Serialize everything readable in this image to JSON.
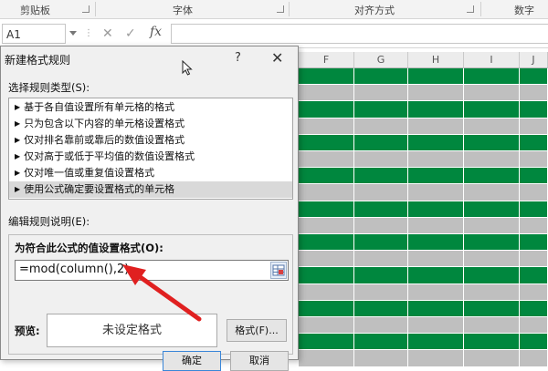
{
  "ribbon": {
    "groups": [
      "剪贴板",
      "字体",
      "对齐方式",
      "数字"
    ]
  },
  "formula_bar": {
    "name_box": "A1",
    "cancel_icon": "✕",
    "enter_icon": "✓",
    "fx_label": "fx",
    "value": ""
  },
  "sheet": {
    "columns": [
      "F",
      "G",
      "H",
      "I",
      "J"
    ],
    "stripe_colors": {
      "green": "#00873e",
      "gray": "#bfbfbf"
    }
  },
  "dialog": {
    "title": "新建格式规则",
    "help_icon": "?",
    "close_icon": "✕",
    "select_rule_type_label": "选择规则类型(S):",
    "rule_types": [
      "基于各自值设置所有单元格的格式",
      "只为包含以下内容的单元格设置格式",
      "仅对排名靠前或靠后的数值设置格式",
      "仅对高于或低于平均值的数值设置格式",
      "仅对唯一值或重复值设置格式",
      "使用公式确定要设置格式的单元格"
    ],
    "selected_rule_index": 5,
    "edit_rule_label": "编辑规则说明(E):",
    "formula_label": "为符合此公式的值设置格式(O):",
    "formula_value": "=mod(column(),2)",
    "preview_label": "预览:",
    "preview_text": "未设定格式",
    "format_button": "格式(F)...",
    "ok_button": "确定",
    "cancel_button": "取消"
  },
  "annotation": {
    "arrow_color": "#e02020"
  }
}
